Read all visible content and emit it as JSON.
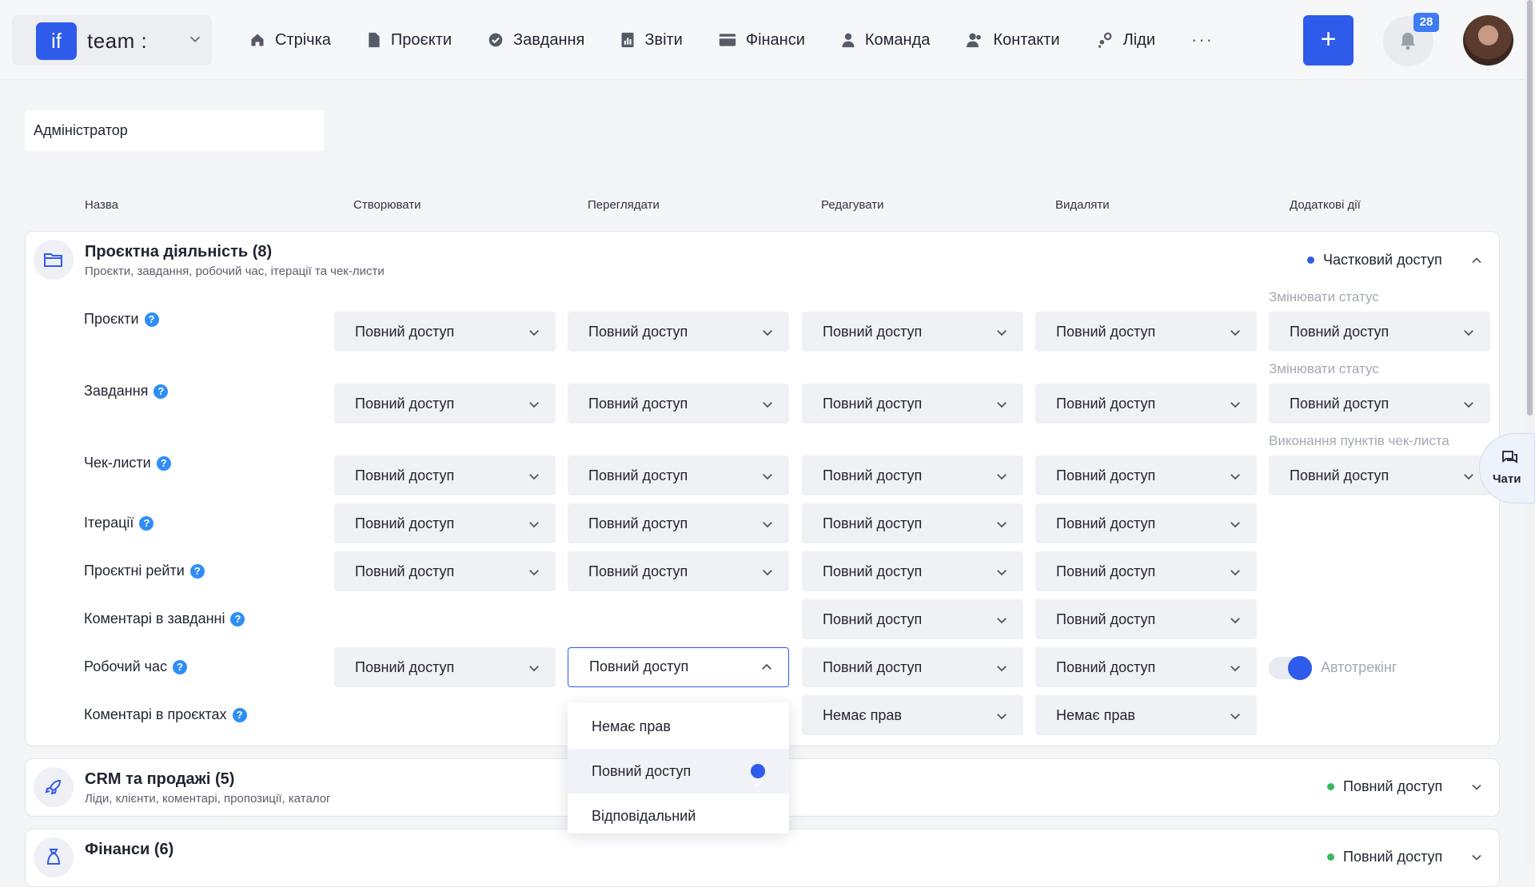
{
  "header": {
    "brand_logo": "if",
    "brand_name": "team :",
    "nav": [
      {
        "label": "Стрічка",
        "icon": "home-icon"
      },
      {
        "label": "Проєкти",
        "icon": "file-icon"
      },
      {
        "label": "Завдання",
        "icon": "check-circle-icon"
      },
      {
        "label": "Звіти",
        "icon": "report-icon"
      },
      {
        "label": "Фінанси",
        "icon": "card-icon"
      },
      {
        "label": "Команда",
        "icon": "user-icon"
      },
      {
        "label": "Контакти",
        "icon": "contacts-icon"
      },
      {
        "label": "Ліди",
        "icon": "leads-icon"
      }
    ],
    "more": "···",
    "add": "+",
    "notifications": "28"
  },
  "role": {
    "name": "Адміністратор"
  },
  "columns": [
    "Назва",
    "Створювати",
    "Переглядати",
    "Редагувати",
    "Видаляти",
    "Додаткові дії"
  ],
  "sections": [
    {
      "title": "Проєктна діяльність (8)",
      "subtitle": "Проєкти, завдання, робочий час, ітерації та чек-листи",
      "status": "Частковий доступ",
      "status_color": "#2f5bea",
      "expanded": true
    },
    {
      "title": "CRM та продажі (5)",
      "subtitle": "Ліди, клієнти, коментарі, пропозиції, каталог",
      "status": "Повний доступ",
      "status_color": "#3cb85a",
      "expanded": false
    },
    {
      "title": "Фінанси (6)",
      "subtitle": "",
      "status": "Повний доступ",
      "status_color": "#3cb85a",
      "expanded": false
    }
  ],
  "rows": [
    {
      "label": "Проєкти",
      "create": "Повний доступ",
      "view": "Повний доступ",
      "edit": "Повний доступ",
      "delete": "Повний доступ",
      "extra_label": "Змінювати статус",
      "extra": "Повний доступ"
    },
    {
      "label": "Завдання",
      "create": "Повний доступ",
      "view": "Повний доступ",
      "edit": "Повний доступ",
      "delete": "Повний доступ",
      "extra_label": "Змінювати статус",
      "extra": "Повний доступ"
    },
    {
      "label": "Чек-листи",
      "create": "Повний доступ",
      "view": "Повний доступ",
      "edit": "Повний доступ",
      "delete": "Повний доступ",
      "extra_label": "Виконання пунктів чек-листа",
      "extra": "Повний доступ"
    },
    {
      "label": "Ітерації",
      "create": "Повний доступ",
      "view": "Повний доступ",
      "edit": "Повний доступ",
      "delete": "Повний доступ"
    },
    {
      "label": "Проєктні рейти",
      "create": "Повний доступ",
      "view": "Повний доступ",
      "edit": "Повний доступ",
      "delete": "Повний доступ"
    },
    {
      "label": "Коментарі в завданні",
      "edit": "Повний доступ",
      "delete": "Повний доступ"
    },
    {
      "label": "Робочий час",
      "create": "Повний доступ",
      "view": "Повний доступ",
      "edit": "Повний доступ",
      "delete": "Повний доступ",
      "toggle_label": "Автотрекінг",
      "toggle_on": true
    },
    {
      "label": "Коментарі в проєктах",
      "edit": "Немає прав",
      "delete": "Немає прав"
    }
  ],
  "help_glyph": "?",
  "dropdown": {
    "options": [
      "Немає прав",
      "Повний доступ",
      "Відповідальний"
    ],
    "selected": "Повний доступ"
  },
  "chat": {
    "label": "Чати"
  }
}
